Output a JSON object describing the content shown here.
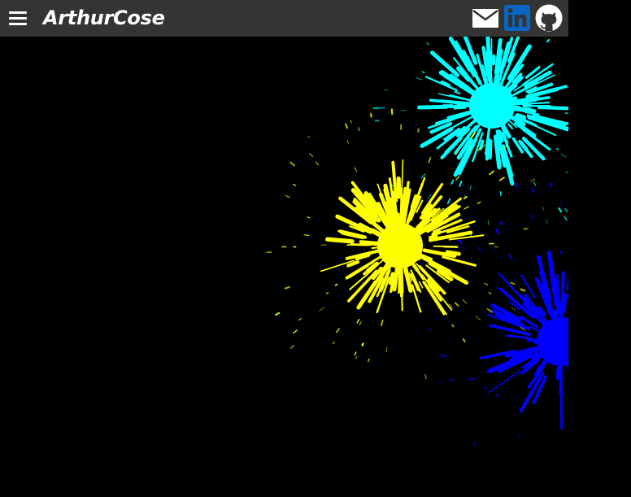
{
  "navbar": {
    "brand": "ArthurCose",
    "icons": [
      "menu-icon",
      "mail-icon",
      "linkedin-icon",
      "github-icon"
    ]
  },
  "colors": {
    "navbar_bg": "#343434",
    "page_bg": "#000000",
    "firework_cyan": "#00ffff",
    "firework_yellow": "#ffff00",
    "firework_blue": "#0000ff",
    "linkedin_blue": "#0a66c2"
  }
}
